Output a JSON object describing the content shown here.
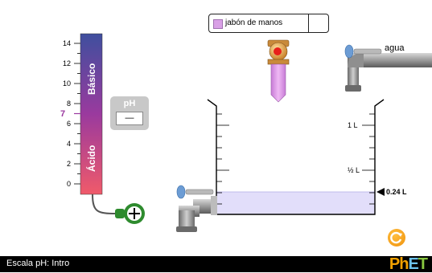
{
  "app": {
    "footer_title": "Escala pH: Intro",
    "logo_text": "PhET"
  },
  "solute_selector": {
    "selected": "jabón de manos",
    "swatch_color": "#d9a0e6",
    "arrow_icon": "triangle-down-icon"
  },
  "ph_scale": {
    "ticks": [
      "14",
      "12",
      "10",
      "8",
      "6",
      "4",
      "2",
      "0"
    ],
    "neutral_marker": "7",
    "basic_label": "Básico",
    "acidic_label": "Ácido",
    "gradient_top": "#3f4f9e",
    "gradient_bottom": "#f05a6a"
  },
  "ph_meter": {
    "title": "pH",
    "value": "—"
  },
  "water_faucet": {
    "label": "agua"
  },
  "beaker": {
    "mark_1L": "1 L",
    "mark_half_L": "½ L",
    "volume_readout": "0.24 L",
    "liquid_color": "#e2defa"
  },
  "colors": {
    "logo_ph": "#f2a100",
    "logo_e": "#6cc2ec",
    "logo_t": "#88c640",
    "probe_green": "#2e8b2e",
    "dropper_color": "#e1a2ea"
  }
}
